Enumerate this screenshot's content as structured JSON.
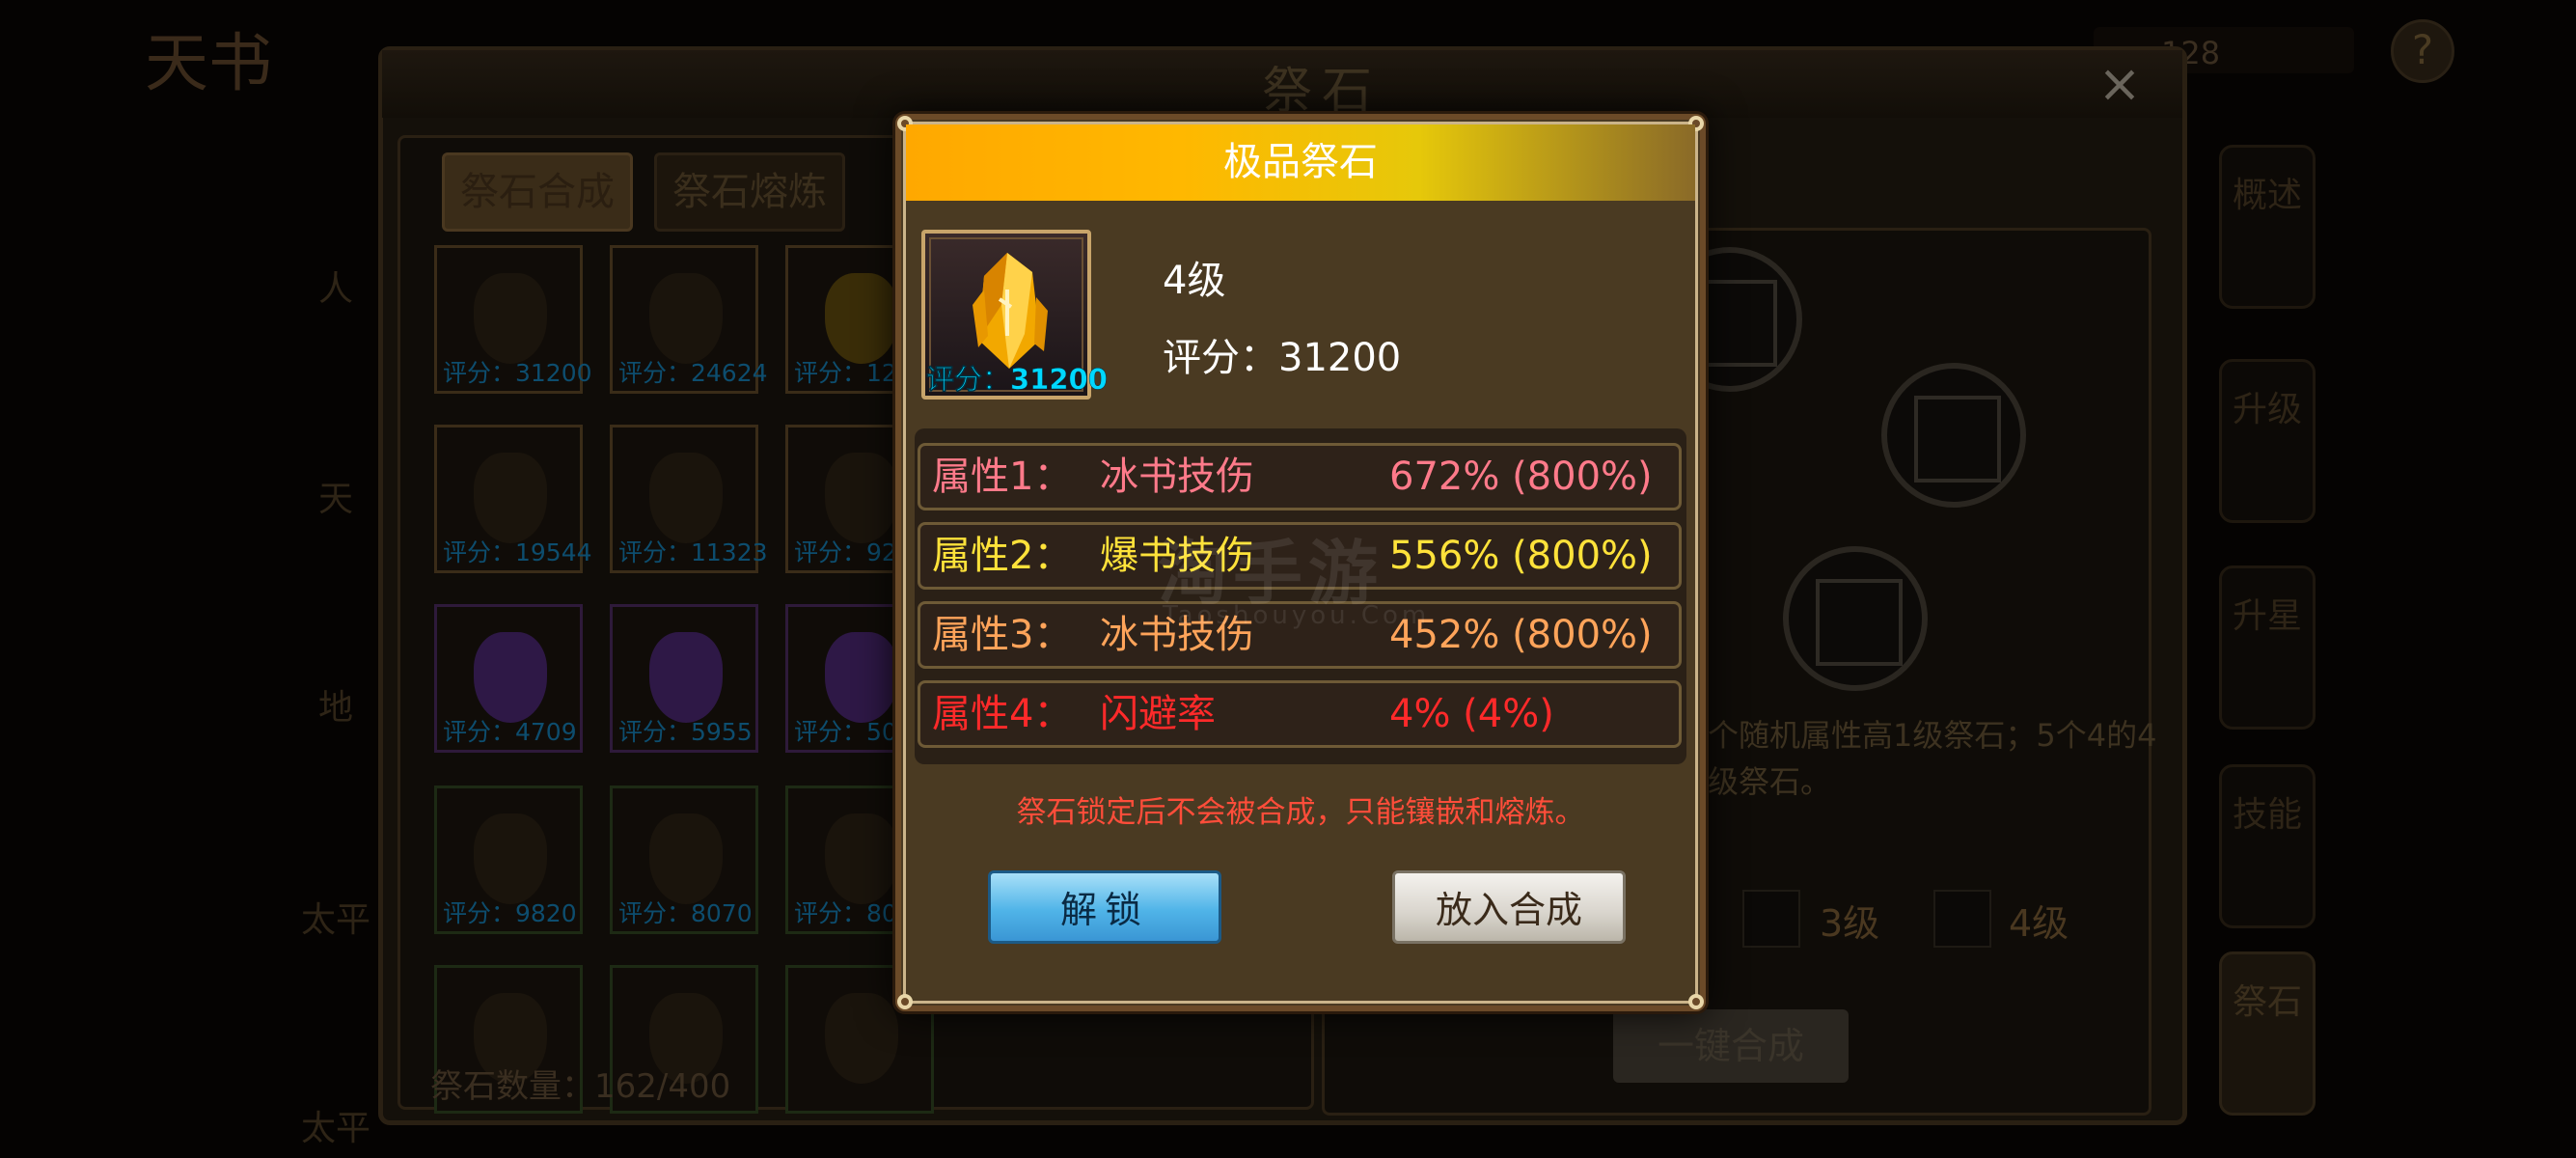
{
  "background": {
    "top_title": "天书",
    "resource_value": "128",
    "help_icon": "?",
    "window_title": "祭石",
    "close_icon": "×",
    "tabs": [
      "祭石合成",
      "祭石熔炼"
    ],
    "grid": [
      [
        {
          "score": "评分：31200",
          "kind": "lock"
        },
        {
          "score": "评分：24624",
          "kind": "lock"
        },
        {
          "score": "评分：12",
          "kind": "yellow"
        }
      ],
      [
        {
          "score": "评分：19544",
          "kind": "lock"
        },
        {
          "score": "评分：11323",
          "kind": "lock"
        },
        {
          "score": "评分：92",
          "kind": "lock"
        }
      ],
      [
        {
          "score": "评分：4709",
          "kind": "purple"
        },
        {
          "score": "评分：5955",
          "kind": "purple"
        },
        {
          "score": "评分：50",
          "kind": "purple"
        }
      ],
      [
        {
          "score": "评分：9820",
          "kind": "lock"
        },
        {
          "score": "评分：8070",
          "kind": "lock"
        },
        {
          "score": "评分：80",
          "kind": "lock"
        }
      ],
      [
        {
          "score": "",
          "kind": "lock"
        },
        {
          "score": "",
          "kind": "lock"
        },
        {
          "score": "",
          "kind": "lock"
        }
      ]
    ],
    "stone_count": "祭石数量：162/400",
    "left_side_labels": [
      "人",
      "天",
      "地",
      "太平",
      "太平"
    ],
    "description": "个随机属性高1级祭石；5个4的4级祭石。",
    "level_options": [
      "3级",
      "4级"
    ],
    "one_key_button": "一键合成",
    "right_tabs": [
      "概述",
      "升级",
      "升星",
      "技能",
      "祭石"
    ]
  },
  "modal": {
    "title": "极品祭石",
    "item": {
      "score_badge": "评分：31200",
      "level": "4级",
      "rating": "评分：31200",
      "icon": "yellow-crystal-icon"
    },
    "attributes": [
      {
        "label": "属性1：",
        "name": "冰书技伤",
        "value": "672% (800%)",
        "color": "#ff7a8a"
      },
      {
        "label": "属性2：",
        "name": "爆书技伤",
        "value": "556% (800%)",
        "color": "#ffe23a"
      },
      {
        "label": "属性3：",
        "name": "冰书技伤",
        "value": "452% (800%)",
        "color": "#ffa45a"
      },
      {
        "label": "属性4：",
        "name": "闪避率",
        "value": "4% (4%)",
        "color": "#ff2a2a"
      }
    ],
    "notice": "祭石锁定后不会被合成，只能镶嵌和熔炼。",
    "unlock_button": "解锁",
    "compose_button": "放入合成"
  },
  "watermark": {
    "main": "淘手游",
    "sub": "Taoshouyou.Com"
  }
}
